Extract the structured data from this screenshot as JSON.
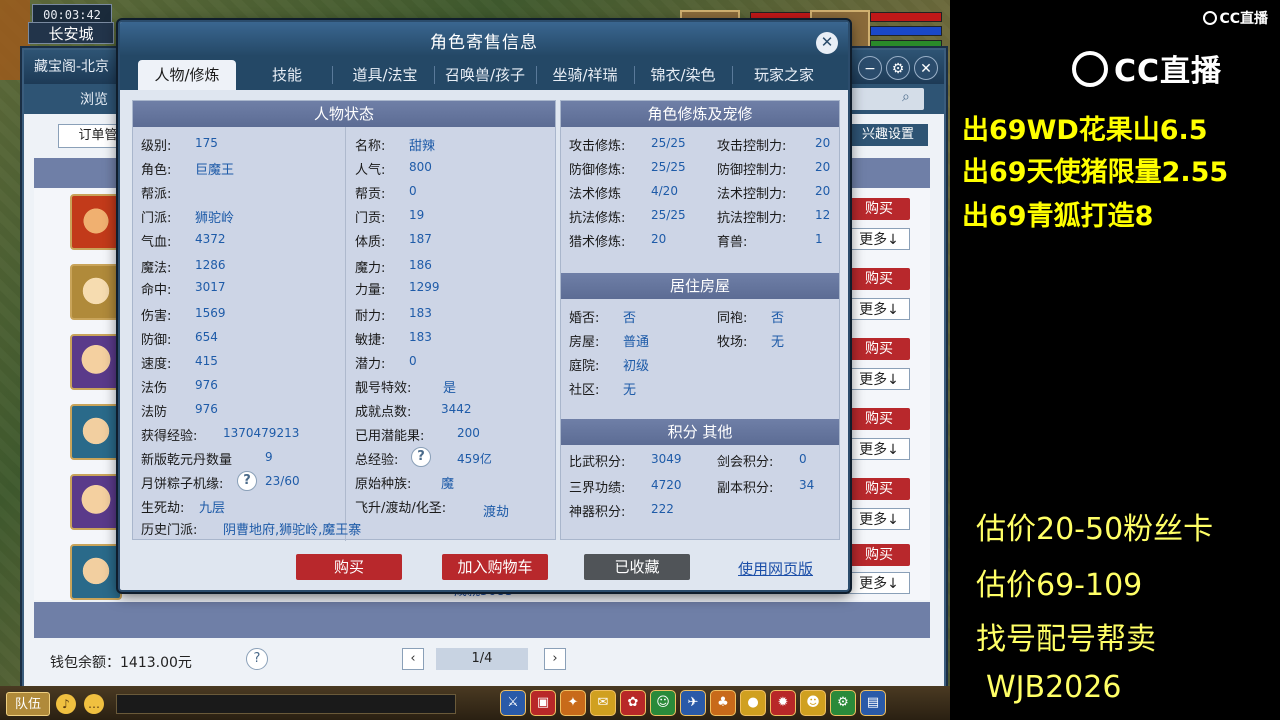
{
  "game": {
    "clock": "00:03:42",
    "city": "长安城",
    "team_label": "队伍"
  },
  "bg_window": {
    "title": "藏宝阁-北京",
    "browse_tab": "浏览",
    "order_button": "订单管",
    "interest_button": "兴趣设置",
    "buy_label": "购买",
    "more_label": "更多↓",
    "row_link": "成就5083",
    "wallet": "钱包余额：1413.00元",
    "page": "1/4"
  },
  "modal": {
    "title": "角色寄售信息",
    "tabs": [
      "人物/修炼",
      "技能",
      "道具/法宝",
      "召唤兽/孩子",
      "坐骑/祥瑞",
      "锦衣/染色",
      "玩家之家"
    ],
    "sections": {
      "status": "人物状态",
      "cultivation": "角色修炼及宠修",
      "house": "居住房屋",
      "points": "积分 其他"
    },
    "status_left": [
      {
        "label": "级别:",
        "value": "175"
      },
      {
        "label": "角色:",
        "value": "巨魔王"
      },
      {
        "label": "帮派:",
        "value": ""
      },
      {
        "label": "门派:",
        "value": "狮驼岭"
      },
      {
        "label": "气血:",
        "value": "4372"
      },
      {
        "label": "魔法:",
        "value": "1286"
      },
      {
        "label": "命中:",
        "value": "3017"
      },
      {
        "label": "伤害:",
        "value": "1569"
      },
      {
        "label": "防御:",
        "value": "654"
      },
      {
        "label": "速度:",
        "value": "415"
      },
      {
        "label": "法伤",
        "value": "976"
      },
      {
        "label": "法防",
        "value": "976"
      },
      {
        "label": "获得经验:",
        "value": "1370479213"
      },
      {
        "label": "新版乾元丹数量",
        "value": "9"
      },
      {
        "label": "月饼粽子机缘:",
        "value": "23/60"
      },
      {
        "label": "生死劫:",
        "value": "九层"
      }
    ],
    "status_right": [
      {
        "label": "名称:",
        "value": "甜辣"
      },
      {
        "label": "人气:",
        "value": "800"
      },
      {
        "label": "帮贡:",
        "value": "0"
      },
      {
        "label": "门贡:",
        "value": "19"
      },
      {
        "label": "体质:",
        "value": "187"
      },
      {
        "label": "魔力:",
        "value": "186"
      },
      {
        "label": "力量:",
        "value": "1299"
      },
      {
        "label": "耐力:",
        "value": "183"
      },
      {
        "label": "敏捷:",
        "value": "183"
      },
      {
        "label": "潜力:",
        "value": "0"
      },
      {
        "label": "靓号特效:",
        "value": "是"
      },
      {
        "label": "成就点数:",
        "value": "3442"
      },
      {
        "label": "已用潜能果:",
        "value": "200"
      },
      {
        "label": "总经验:",
        "value": "459亿"
      },
      {
        "label": "原始种族:",
        "value": "魔"
      },
      {
        "label": "飞升/渡劫/化圣:",
        "value": "渡劫"
      }
    ],
    "history_label": "历史门派:",
    "history_value": "阴曹地府,狮驼岭,魔王寨",
    "cultivation_left": [
      {
        "label": "攻击修炼:",
        "value": "25/25"
      },
      {
        "label": "防御修炼:",
        "value": "25/25"
      },
      {
        "label": "法术修炼",
        "value": "4/20"
      },
      {
        "label": "抗法修炼:",
        "value": "25/25"
      },
      {
        "label": "猎术修炼:",
        "value": "20"
      }
    ],
    "cultivation_right": [
      {
        "label": "攻击控制力:",
        "value": "20"
      },
      {
        "label": "防御控制力:",
        "value": "20"
      },
      {
        "label": "法术控制力:",
        "value": "20"
      },
      {
        "label": "抗法控制力:",
        "value": "12"
      },
      {
        "label": "育兽:",
        "value": "1"
      }
    ],
    "house_left": [
      {
        "label": "婚否:",
        "value": "否"
      },
      {
        "label": "房屋:",
        "value": "普通"
      },
      {
        "label": "庭院:",
        "value": "初级"
      },
      {
        "label": "社区:",
        "value": "无"
      }
    ],
    "house_right": [
      {
        "label": "同袍:",
        "value": "否"
      },
      {
        "label": "牧场:",
        "value": "无"
      }
    ],
    "points_left": [
      {
        "label": "比武积分:",
        "value": "3049"
      },
      {
        "label": "三界功绩:",
        "value": "4720"
      },
      {
        "label": "神器积分:",
        "value": "222"
      }
    ],
    "points_right": [
      {
        "label": "剑会积分:",
        "value": "0"
      },
      {
        "label": "副本积分:",
        "value": "34"
      }
    ],
    "buttons": {
      "buy": "购买",
      "cart": "加入购物车",
      "saved": "已收藏",
      "web": "使用网页版"
    }
  },
  "overlay": {
    "cc_small": "CC直播",
    "cc_logo": "CC直播",
    "promos": [
      "出69WD花果山6.5",
      "出69天使猪限量2.55",
      "出69青狐打造8"
    ],
    "prices": [
      "估价20-50粉丝卡",
      "估价69-109",
      "找号配号帮卖",
      "WJB2026"
    ]
  }
}
